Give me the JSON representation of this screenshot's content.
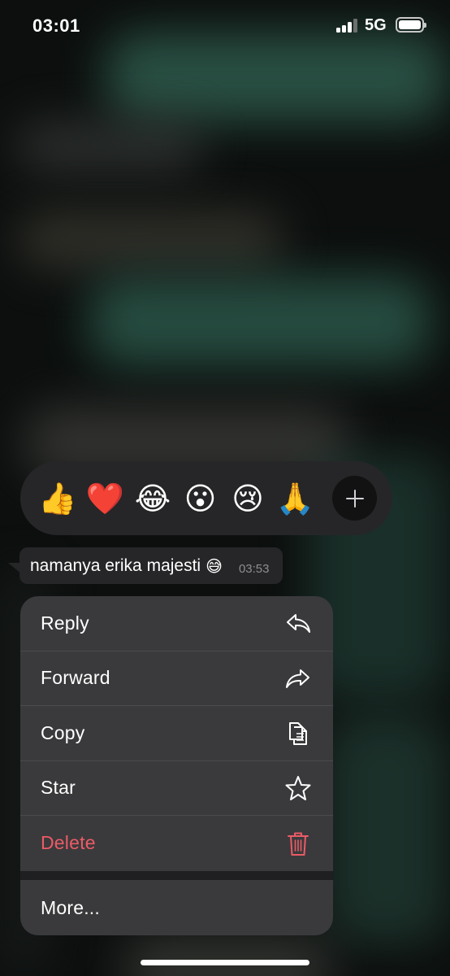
{
  "status_bar": {
    "time": "03:01",
    "network": "5G",
    "signal_bars": 3,
    "battery_level": 1.0
  },
  "reactions": {
    "emojis": [
      {
        "glyph": "👍",
        "name": "thumbs-up"
      },
      {
        "glyph": "❤️",
        "name": "red-heart"
      },
      {
        "glyph": "😂",
        "name": "tears-of-joy"
      },
      {
        "glyph": "😮",
        "name": "open-mouth"
      },
      {
        "glyph": "😢",
        "name": "crying-face"
      },
      {
        "glyph": "🙏",
        "name": "folded-hands"
      }
    ],
    "add_icon": "plus-icon"
  },
  "message": {
    "text": "namanya erika majesti",
    "emoji": "😅",
    "time": "03:53"
  },
  "menu": {
    "items": [
      {
        "label": "Reply",
        "icon": "reply-icon"
      },
      {
        "label": "Forward",
        "icon": "forward-icon"
      },
      {
        "label": "Copy",
        "icon": "copy-icon"
      },
      {
        "label": "Star",
        "icon": "star-icon"
      },
      {
        "label": "Delete",
        "icon": "trash-icon",
        "destructive": true
      }
    ],
    "more_label": "More..."
  },
  "colors": {
    "menu_background": "#3a3a3c",
    "bubble_background": "#262628",
    "destructive": "#eb5b67",
    "timestamp": "#8e8e93"
  }
}
